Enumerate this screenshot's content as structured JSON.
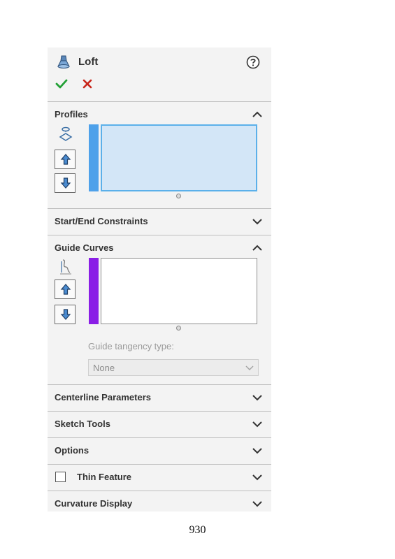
{
  "header": {
    "title": "Loft"
  },
  "colors": {
    "profiles_accent": "#4ea1ea",
    "profiles_list_fill": "#d3e6f7",
    "guide_accent": "#8a1ee6",
    "ok_green": "#22a035",
    "cancel_red": "#c8251a"
  },
  "icons": {
    "title": "loft-icon",
    "help": "help-icon",
    "ok": "check-icon",
    "cancel": "close-icon",
    "profiles_selection": "profile-selection-icon",
    "guide_selection": "guide-curve-icon",
    "move_up": "arrow-up-icon",
    "move_down": "arrow-down-icon"
  },
  "sections": {
    "profiles": {
      "label": "Profiles",
      "expanded": true
    },
    "start_end": {
      "label": "Start/End Constraints",
      "expanded": false
    },
    "guide_curves": {
      "label": "Guide Curves",
      "expanded": true
    },
    "centerline": {
      "label": "Centerline Parameters",
      "expanded": false
    },
    "sketch_tools": {
      "label": "Sketch Tools",
      "expanded": false
    },
    "options": {
      "label": "Options",
      "expanded": false
    },
    "thin_feature": {
      "label": "Thin Feature",
      "expanded": false,
      "checked": false
    },
    "curvature": {
      "label": "Curvature Display",
      "expanded": false
    }
  },
  "guide_tangency": {
    "label": "Guide tangency type:",
    "value": "None"
  },
  "page": {
    "number": "930"
  }
}
